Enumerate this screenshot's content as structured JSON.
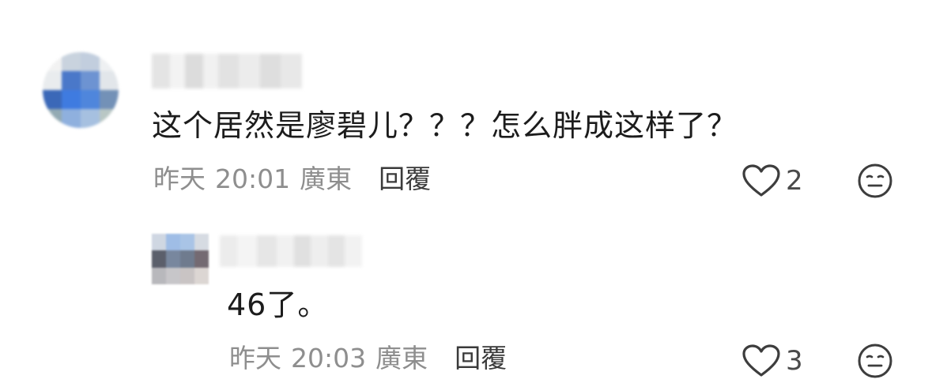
{
  "comments": [
    {
      "text": "这个居然是廖碧儿？？？怎么胖成这样了？",
      "date": "昨天",
      "time": "20:01",
      "location": "廣東",
      "reply_label": "回覆",
      "likes": "2"
    },
    {
      "text": "46了。",
      "date": "昨天",
      "time": "20:03",
      "location": "廣東",
      "reply_label": "回覆",
      "likes": "3"
    }
  ],
  "icons": {
    "like": "heart-outline-icon",
    "reaction": "neutral-face-icon"
  },
  "colors": {
    "text": "#1c1c1c",
    "meta": "#8e8e8e",
    "reply": "#3a3a3a",
    "icon": "#3d3d3d"
  }
}
